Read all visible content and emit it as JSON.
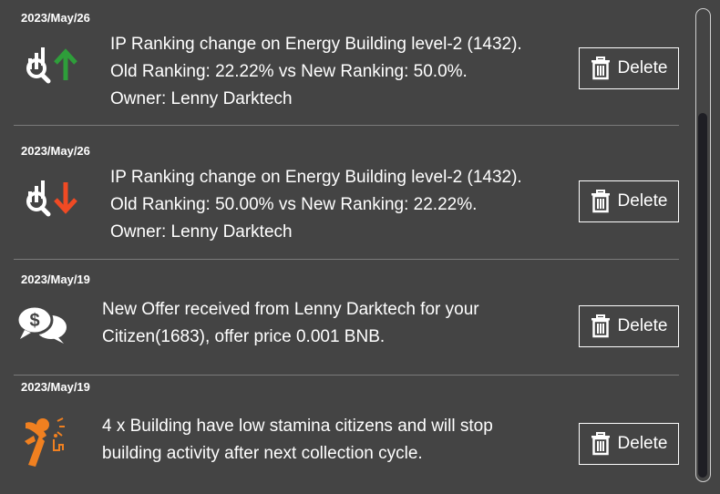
{
  "notifications": [
    {
      "date": "2023/May/26",
      "lines": [
        "IP Ranking change on Energy Building level-2 (1432).",
        "Old Ranking: 22.22% vs New Ranking: 50.0%.",
        "Owner: Lenny Darktech"
      ],
      "icon": "ranking-up-icon",
      "arrow_color": "#2e9e3a",
      "delete_label": "Delete"
    },
    {
      "date": "2023/May/26",
      "lines": [
        "IP Ranking change on Energy Building level-2 (1432).",
        "Old Ranking: 50.00% vs New Ranking: 22.22%.",
        "Owner: Lenny Darktech"
      ],
      "icon": "ranking-down-icon",
      "arrow_color": "#f04a24",
      "delete_label": "Delete"
    },
    {
      "date": "2023/May/19",
      "lines": [
        "New Offer received from Lenny Darktech for your",
        "Citizen(1683), offer price 0.001 BNB."
      ],
      "icon": "offer-chat-icon",
      "delete_label": "Delete"
    },
    {
      "date": "2023/May/19",
      "lines": [
        "4 x Building have low stamina citizens and will stop",
        "building activity after next collection cycle."
      ],
      "icon": "tired-citizen-icon",
      "icon_color": "#f08020",
      "delete_label": "Delete"
    }
  ]
}
